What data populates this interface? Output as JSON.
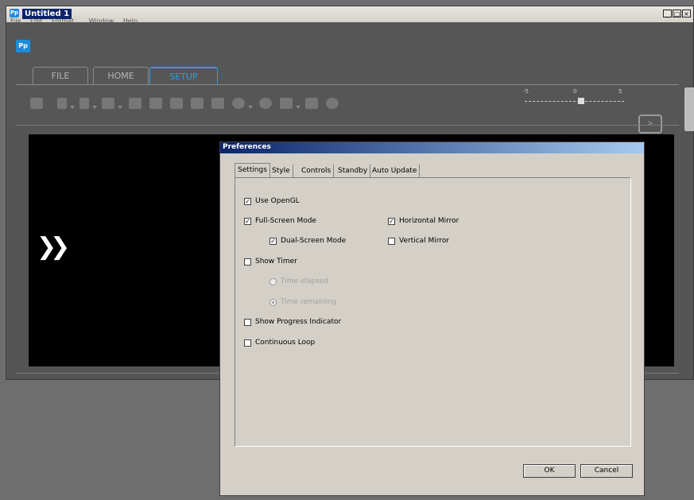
{
  "window": {
    "title": "Untitled 1",
    "app_icon": "Pp"
  },
  "menu": [
    "File",
    "Edit",
    "Format",
    "Window",
    "Help"
  ],
  "logo": "Pp",
  "tabs": [
    {
      "label": "FILE"
    },
    {
      "label": "HOME"
    },
    {
      "label": "SETUP"
    }
  ],
  "slider": {
    "min_label": "-5",
    "mid_label": "0",
    "max_label": "5",
    "value": 0
  },
  "dialog": {
    "title": "Preferences",
    "tabs": [
      "Settings",
      "Style",
      "Controls",
      "Standby",
      "Auto Update"
    ],
    "options": {
      "use_opengl": {
        "label": "Use OpenGL",
        "checked": true
      },
      "full_screen": {
        "label": "Full-Screen Mode",
        "checked": true
      },
      "dual_screen": {
        "label": "Dual-Screen Mode",
        "checked": true
      },
      "horizontal_mirror": {
        "label": "Horizontal Mirror",
        "checked": true
      },
      "vertical_mirror": {
        "label": "Vertical Mirror",
        "checked": false
      },
      "show_timer": {
        "label": "Show Timer",
        "checked": false
      },
      "time_elapsed": {
        "label": "Time elapsed",
        "selected": false
      },
      "time_remaining": {
        "label": "Time remaining",
        "selected": true
      },
      "show_progress": {
        "label": "Show Progress Indicator",
        "checked": false
      },
      "continuous_loop": {
        "label": "Continuous Loop",
        "checked": false
      }
    },
    "ok_label": "OK",
    "cancel_label": "Cancel"
  },
  "colors": {
    "accent": "#2aa0dc",
    "dialog_title_start": "#0a246a",
    "dialog_title_end": "#a6caf0"
  }
}
